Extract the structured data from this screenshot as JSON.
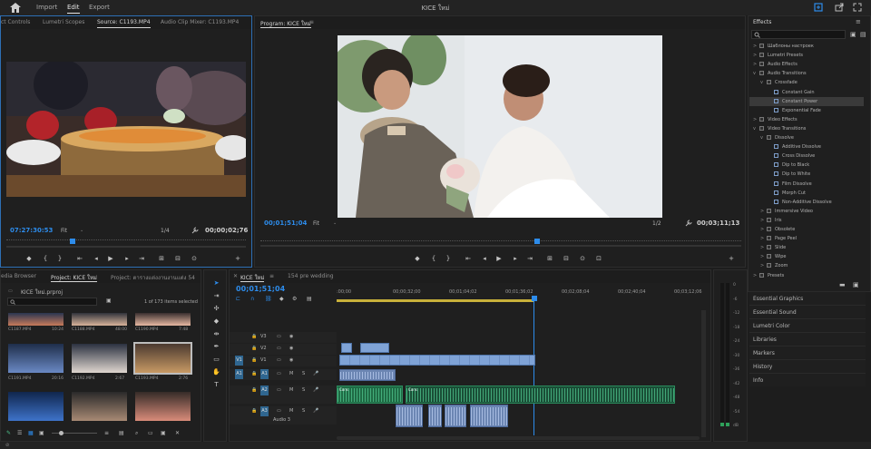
{
  "app": {
    "title": "KICE ใหม่",
    "workspaces": [
      "Import",
      "Edit",
      "Export"
    ],
    "active_workspace": "Edit"
  },
  "source_panel": {
    "tabs": [
      "ct Controls",
      "Lumetri Scopes",
      "Source: C1193.MP4",
      "Audio Clip Mixer: C1193.MP4"
    ],
    "active_tab": "Source: C1193.MP4",
    "timecode": "07:27:30:53",
    "fit": "Fit",
    "ratio": "1/4",
    "duration": "00;00;02;76"
  },
  "program_panel": {
    "tab": "Program: KICE ใหม่",
    "timecode": "00;01;51;04",
    "fit": "Fit",
    "ratio": "1/2",
    "duration": "00;03;11;13"
  },
  "effects_panel": {
    "title": "Effects",
    "items": [
      {
        "label": "Шаблоны настроек",
        "level": 0,
        "type": "folder",
        "twirl": ">"
      },
      {
        "label": "Lumetri Presets",
        "level": 0,
        "type": "folder",
        "twirl": ">"
      },
      {
        "label": "Audio Effects",
        "level": 0,
        "type": "folder",
        "twirl": ">"
      },
      {
        "label": "Audio Transitions",
        "level": 0,
        "type": "folder",
        "twirl": "v"
      },
      {
        "label": "Crossfade",
        "level": 1,
        "type": "folder",
        "twirl": "v"
      },
      {
        "label": "Constant Gain",
        "level": 2,
        "type": "effect",
        "twirl": ""
      },
      {
        "label": "Constant Power",
        "level": 2,
        "type": "effect",
        "twirl": "",
        "selected": true
      },
      {
        "label": "Exponential Fade",
        "level": 2,
        "type": "effect",
        "twirl": ""
      },
      {
        "label": "Video Effects",
        "level": 0,
        "type": "folder",
        "twirl": ">"
      },
      {
        "label": "Video Transitions",
        "level": 0,
        "type": "folder",
        "twirl": "v"
      },
      {
        "label": "Dissolve",
        "level": 1,
        "type": "folder",
        "twirl": "v"
      },
      {
        "label": "Additive Dissolve",
        "level": 2,
        "type": "effect",
        "twirl": ""
      },
      {
        "label": "Cross Dissolve",
        "level": 2,
        "type": "effect",
        "twirl": ""
      },
      {
        "label": "Dip to Black",
        "level": 2,
        "type": "effect",
        "twirl": ""
      },
      {
        "label": "Dip to White",
        "level": 2,
        "type": "effect",
        "twirl": ""
      },
      {
        "label": "Film Dissolve",
        "level": 2,
        "type": "effect",
        "twirl": ""
      },
      {
        "label": "Morph Cut",
        "level": 2,
        "type": "effect",
        "twirl": ""
      },
      {
        "label": "Non-Additive Dissolve",
        "level": 2,
        "type": "effect",
        "twirl": ""
      },
      {
        "label": "Immersive Video",
        "level": 1,
        "type": "folder",
        "twirl": ">"
      },
      {
        "label": "Iris",
        "level": 1,
        "type": "folder",
        "twirl": ">"
      },
      {
        "label": "Obsolete",
        "level": 1,
        "type": "folder",
        "twirl": ">"
      },
      {
        "label": "Page Peel",
        "level": 1,
        "type": "folder",
        "twirl": ">"
      },
      {
        "label": "Slide",
        "level": 1,
        "type": "folder",
        "twirl": ">"
      },
      {
        "label": "Wipe",
        "level": 1,
        "type": "folder",
        "twirl": ">"
      },
      {
        "label": "Zoom",
        "level": 1,
        "type": "folder",
        "twirl": ">"
      },
      {
        "label": "Presets",
        "level": 0,
        "type": "folder",
        "twirl": ">"
      }
    ]
  },
  "side_panels": [
    "Essential Graphics",
    "Essential Sound",
    "Lumetri Color",
    "Libraries",
    "Markers",
    "History",
    "Info"
  ],
  "project_panel": {
    "tabs": [
      "edia Browser",
      "Project: KICE ใหม่",
      "Project: ตารางแต่งงานงานแต่ง 54"
    ],
    "active_tab": "Project: KICE ใหม่",
    "file": "KICE ใหม่.prproj",
    "items_selected": "1 of 173 items selected",
    "clips": [
      {
        "name": "C1187.MP4",
        "dur": "10:24"
      },
      {
        "name": "C1188.MP4",
        "dur": "48:00"
      },
      {
        "name": "C1190.MP4",
        "dur": "7:48"
      },
      {
        "name": "C1191.MP4",
        "dur": "20:16"
      },
      {
        "name": "C1192.MP4",
        "dur": "2:67"
      },
      {
        "name": "C1193.MP4",
        "dur": "2:76"
      },
      {
        "name": "",
        "dur": ""
      },
      {
        "name": "",
        "dur": ""
      },
      {
        "name": "",
        "dur": ""
      }
    ]
  },
  "timeline": {
    "tabs": [
      "KICE ใหม่",
      "154 pre wedding"
    ],
    "active_tab": "KICE ใหม่",
    "timecode": "00;01;51;04",
    "ruler": [
      ":00;00",
      "00;00;32;00",
      "00;01;04;02",
      "00;01;36;02",
      "00;02;08;04",
      "00;02;40;04",
      "00;03;12;06"
    ],
    "video_tracks": [
      "V3",
      "V2",
      "V1"
    ],
    "audio_tracks": [
      "A1",
      "A2",
      "A3"
    ],
    "audio3_name": "Audio 3",
    "source_patch": {
      "v": "V1",
      "a": "A1"
    },
    "clip_labels": [
      "Cons",
      "Cons"
    ]
  },
  "meter_scale": [
    "0",
    "-6",
    "-12",
    "-18",
    "-24",
    "-30",
    "-36",
    "-42",
    "-48",
    "-54",
    "dB"
  ]
}
